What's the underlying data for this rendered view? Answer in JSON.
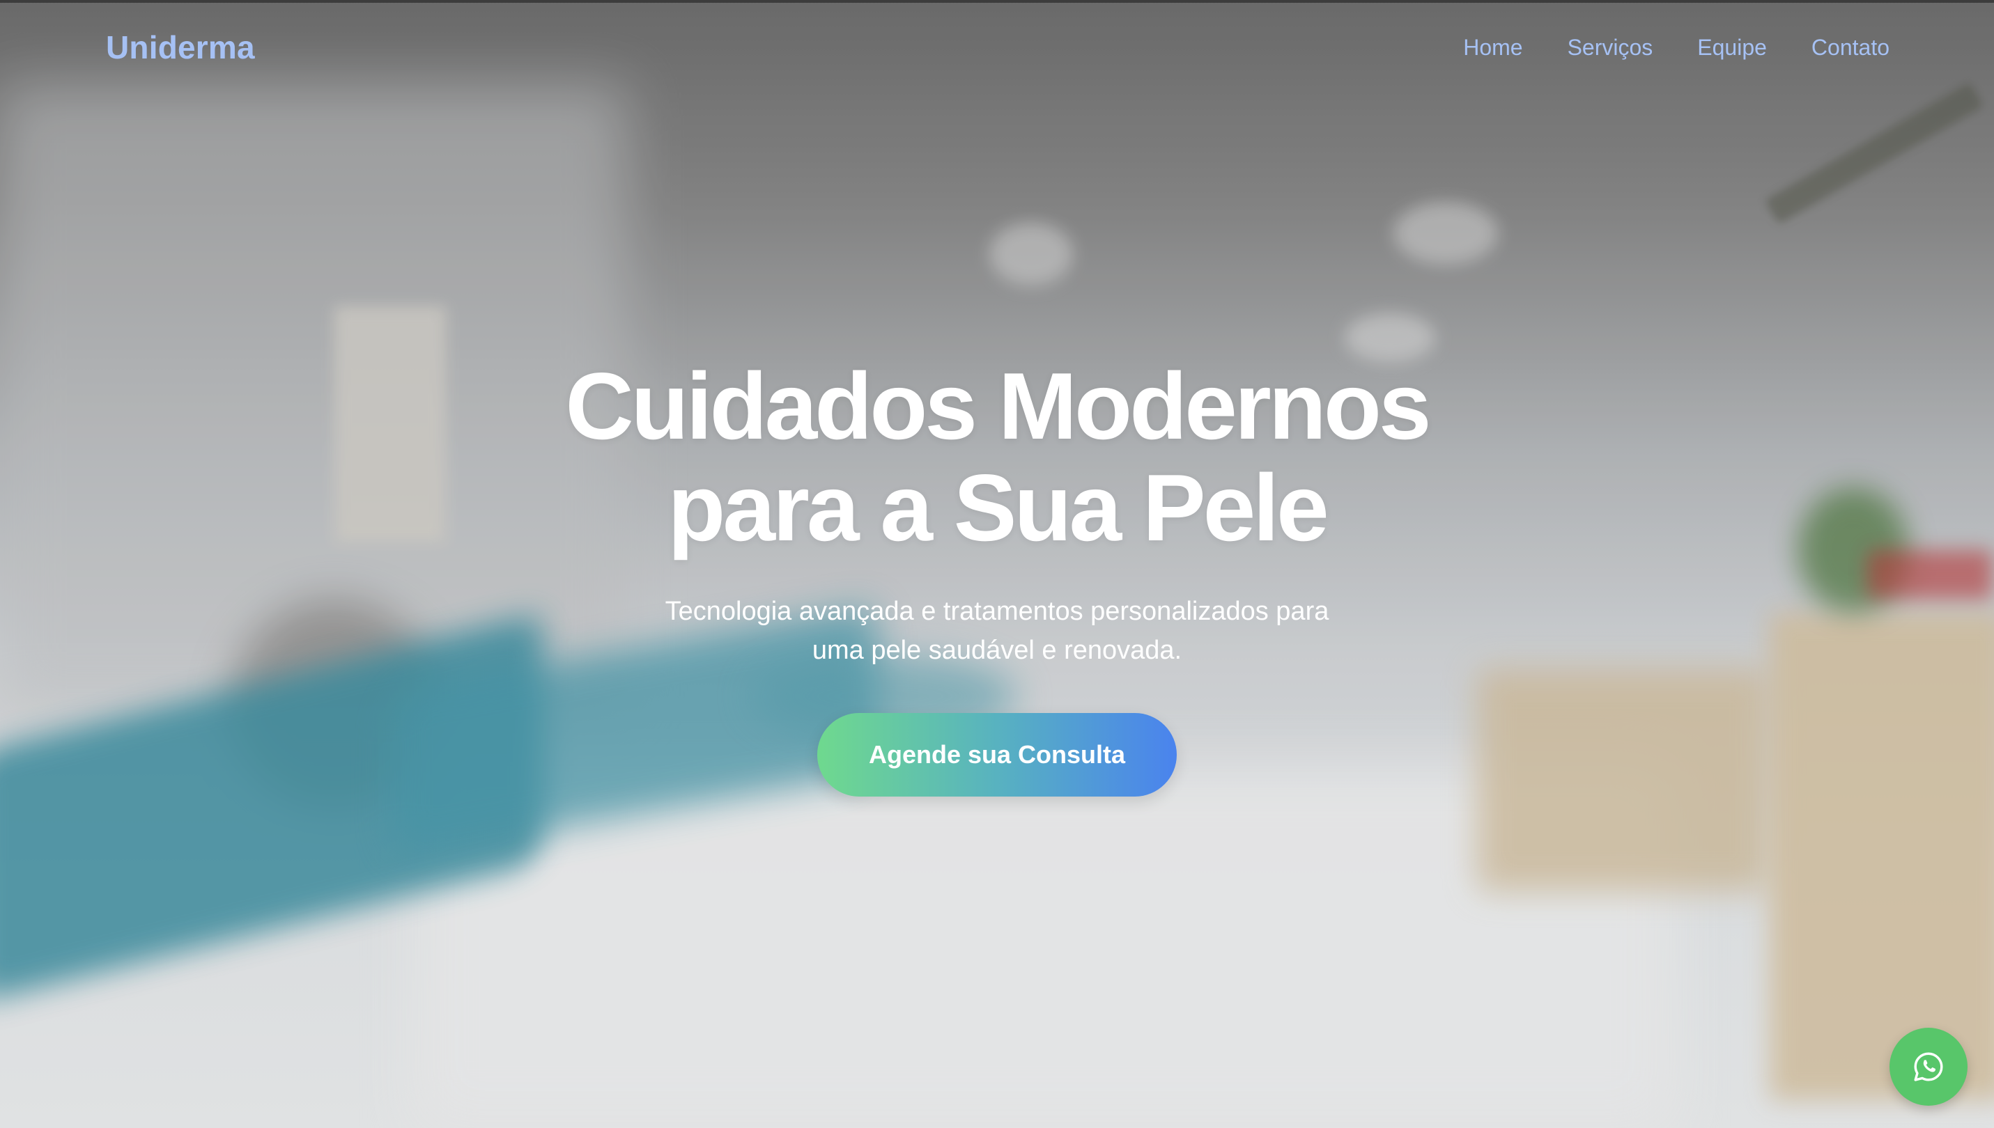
{
  "brand": {
    "name": "Uniderma",
    "color": "#a6c1f4"
  },
  "nav": {
    "items": [
      {
        "label": "Home"
      },
      {
        "label": "Serviços"
      },
      {
        "label": "Equipe"
      },
      {
        "label": "Contato"
      }
    ]
  },
  "hero": {
    "title_line1": "Cuidados Modernos",
    "title_line2": "para a Sua Pele",
    "subtitle_line1": "Tecnologia avançada e tratamentos personalizados para",
    "subtitle_line2": "uma pele saudável e renovada.",
    "cta_label": "Agende sua Consulta",
    "cta_gradient": [
      "#6fd98e",
      "#4a83ee"
    ]
  },
  "floating": {
    "whatsapp_icon": "whatsapp-icon",
    "color": "#58c66a"
  }
}
